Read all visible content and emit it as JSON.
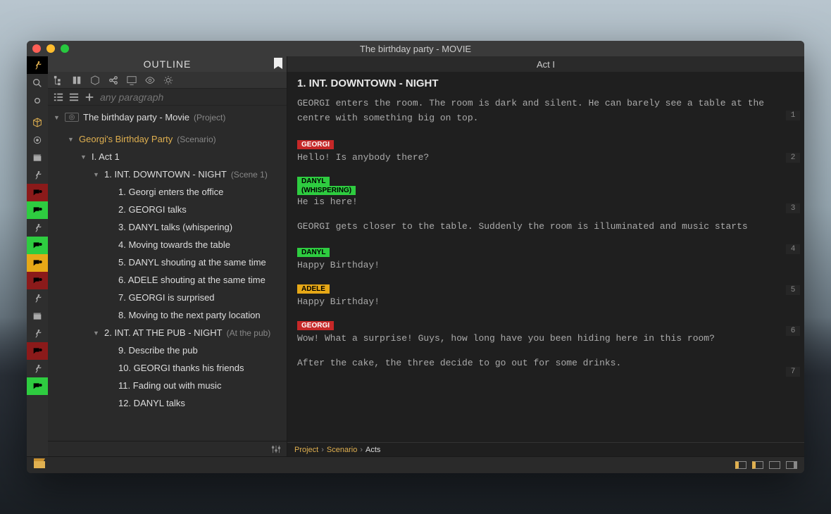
{
  "window": {
    "title": "The birthday party - MOVIE"
  },
  "outline": {
    "title": "OUTLINE",
    "search_placeholder": "any paragraph",
    "project": {
      "label": "The birthday party - Movie",
      "suffix": "(Project)"
    },
    "scenario": {
      "label": "Georgi's Birthday Party",
      "suffix": "(Scenario)"
    },
    "act": {
      "label": "I. Act 1"
    },
    "scenes": [
      {
        "heading": "1. INT.  DOWNTOWN - NIGHT",
        "suffix": "(Scene 1)",
        "beats": [
          "1. Georgi enters the office",
          "2. GEORGI talks",
          "3. DANYL talks (whispering)",
          "4. Moving towards the table",
          "5. DANYL shouting at the same time",
          "6. ADELE shouting at the same time",
          "7. GEORGI is surprised",
          "8. Moving to the next party location"
        ]
      },
      {
        "heading": "2. INT.  AT THE PUB - NIGHT",
        "suffix": "(At the pub)",
        "beats": [
          "9. Describe the pub",
          "10. GEORGI thanks his friends",
          "11. Fading out with music",
          "12. DANYL talks"
        ]
      }
    ]
  },
  "editor": {
    "act_label": "Act I",
    "scene_heading": "1. INT.  DOWNTOWN - NIGHT",
    "blocks": {
      "a1": "GEORGI enters the room. The room is dark and silent. He can barely see a table at the centre with something big on top.",
      "c1": "GEORGI",
      "d1": "Hello! Is anybody there?",
      "c2": "DANYL",
      "p2": "(WHISPERING)",
      "d2": "He is here!",
      "a2": "GEORGI gets closer to the table. Suddenly the room is illuminated and music starts",
      "c3": "DANYL",
      "d3": "Happy Birthday!",
      "c4": "ADELE",
      "d4": "Happy Birthday!",
      "c5": "GEORGI",
      "d5": "Wow! What a surprise! Guys, how long have you been hiding here in this room?",
      "a3": "After the cake, the three decide to go out for some drinks."
    },
    "line_numbers": [
      "1",
      "2",
      "3",
      "4",
      "5",
      "6",
      "7"
    ]
  },
  "breadcrumb": {
    "a": "Project",
    "b": "Scenario",
    "c": "Acts"
  },
  "colors": {
    "accent_gold": "#e0b050",
    "tag_red": "#c62828",
    "tag_green": "#2ecc40",
    "tag_orange": "#e6a817"
  }
}
